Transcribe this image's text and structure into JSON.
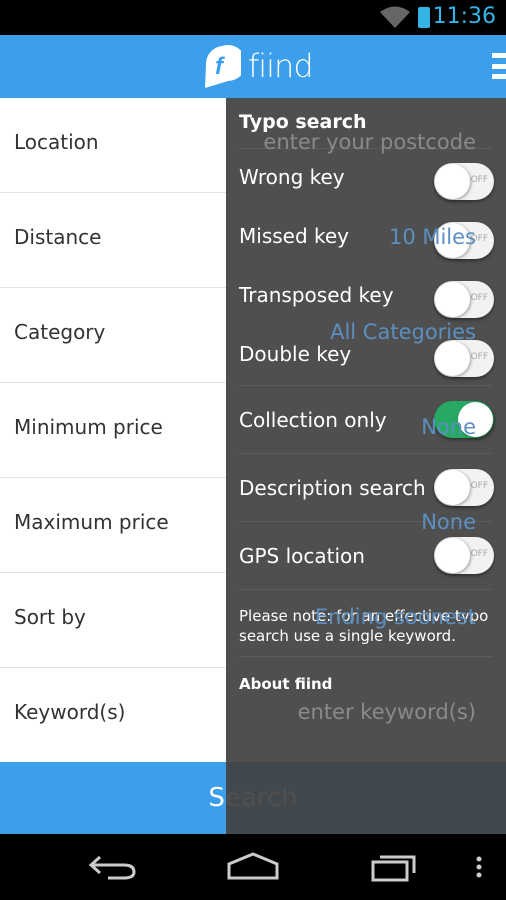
{
  "status_bar": {
    "time": "11:36",
    "icons": [
      "wifi-icon",
      "battery-charging-icon"
    ]
  },
  "app_bar": {
    "logo_letter": "f",
    "logo_text": "fiind",
    "menu_icon": "hamburger-menu-icon"
  },
  "form": {
    "rows": [
      {
        "label": "Location",
        "value": "enter your postcode",
        "placeholder": true
      },
      {
        "label": "Distance",
        "value": "10 Miles"
      },
      {
        "label": "Category",
        "value": "All Categories"
      },
      {
        "label": "Minimum price",
        "value": "None"
      },
      {
        "label": "Maximum price",
        "value": "None"
      },
      {
        "label": "Sort by",
        "value": "Ending soonest"
      },
      {
        "label": "Keyword(s)",
        "value": "enter keyword(s)",
        "placeholder": true
      }
    ],
    "search_label": "Search"
  },
  "panel": {
    "title": "Typo search",
    "toggles": [
      {
        "label": "Wrong key",
        "on": false,
        "state_text": "OFF"
      },
      {
        "label": "Missed key",
        "on": false,
        "state_text": "OFF"
      },
      {
        "label": "Transposed key",
        "on": false,
        "state_text": "OFF"
      },
      {
        "label": "Double key",
        "on": false,
        "state_text": "OFF"
      },
      {
        "label": "Collection only",
        "on": true
      },
      {
        "label": "Description search",
        "on": false,
        "state_text": "OFF"
      },
      {
        "label": "GPS location",
        "on": false,
        "state_text": "OFF"
      }
    ],
    "note": "Please note: for an effective typo search use a single keyword.",
    "about": "About fiind",
    "toggle_on_color": "#27a863"
  },
  "nav_bar": {
    "icons": [
      "back-icon",
      "home-icon",
      "recent-apps-icon",
      "overflow-menu-icon"
    ]
  }
}
